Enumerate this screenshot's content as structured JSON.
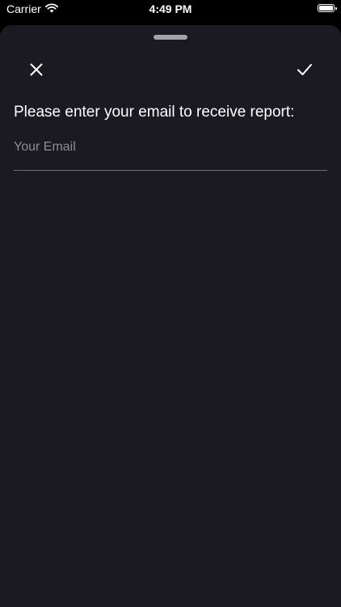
{
  "status_bar": {
    "carrier": "Carrier",
    "time": "4:49 PM",
    "icons": [
      "wifi-icon",
      "battery-icon"
    ]
  },
  "sheet": {
    "close_icon": "close-icon",
    "confirm_icon": "checkmark-icon",
    "prompt": "Please enter your email to receive report:",
    "email_input": {
      "placeholder": "Your Email",
      "value": ""
    }
  },
  "colors": {
    "background": "#000000",
    "sheet": "#1b1a22",
    "text": "#ffffff",
    "placeholder": "#8e8d93",
    "underline": "#6d6c73",
    "grabber": "#a3a2a8"
  }
}
